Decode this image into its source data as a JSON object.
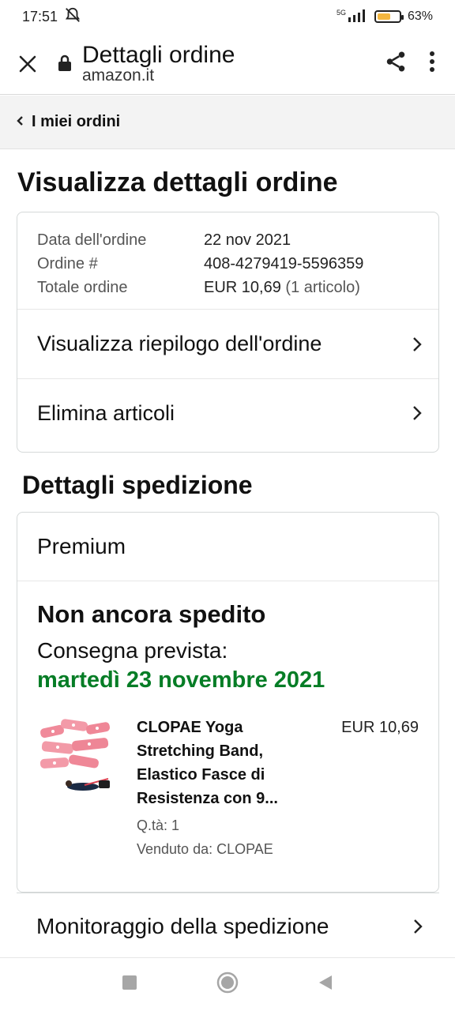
{
  "status_bar": {
    "time": "17:51",
    "network": "5G",
    "battery_percent": "63%",
    "battery_level": 0.63
  },
  "browser": {
    "title": "Dettagli ordine",
    "domain": "amazon.it"
  },
  "breadcrumb": {
    "label": "I miei ordini"
  },
  "page": {
    "heading": "Visualizza dettagli ordine"
  },
  "order": {
    "date_label": "Data dell'ordine",
    "date_value": "22 nov 2021",
    "number_label": "Ordine #",
    "number_value": "408-4279419-5596359",
    "total_label": "Totale ordine",
    "total_value": "EUR 10,69",
    "total_items": "(1 articolo)"
  },
  "actions": {
    "summary": "Visualizza riepilogo dell'ordine",
    "delete": "Elimina articoli"
  },
  "shipment": {
    "heading": "Dettagli spedizione",
    "service": "Premium",
    "status": "Non ancora spedito",
    "delivery_label": "Consegna prevista:",
    "delivery_date": "martedì 23 novembre 2021",
    "item": {
      "title": "CLOPAE Yoga Stretching Band, Elastico Fasce di Resistenza con 9...",
      "price": "EUR 10,69",
      "quantity": "Q.tà: 1",
      "seller": "Venduto da: CLOPAE"
    },
    "tracking": "Monitoraggio della spedizione"
  },
  "colors": {
    "delivery_green": "#067d26",
    "battery": "#f3b63f",
    "band_gray": "#f3f3f3"
  },
  "icons": [
    "close-icon",
    "lock-icon",
    "share-icon",
    "more-vert-icon",
    "chevron-left-icon",
    "chevron-right-icon",
    "recents-icon",
    "home-icon",
    "back-icon"
  ]
}
